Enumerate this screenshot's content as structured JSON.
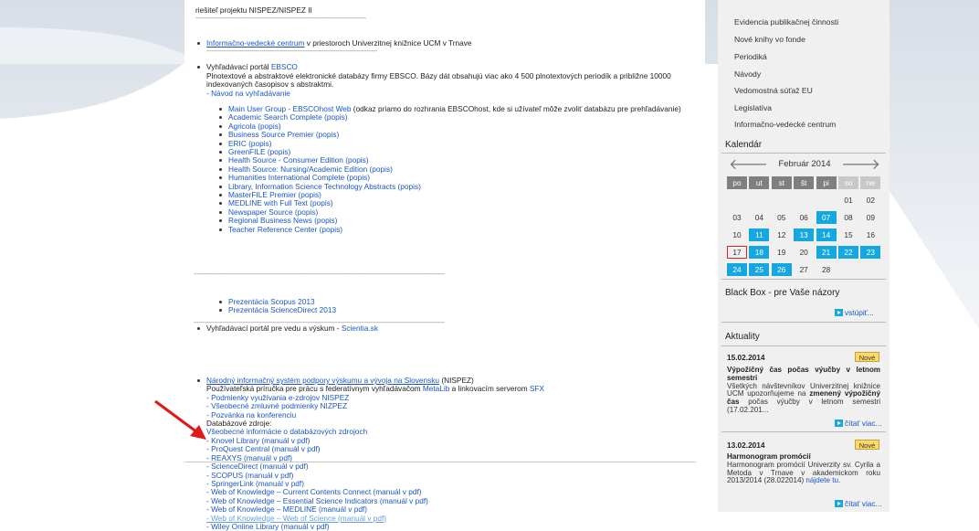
{
  "content": {
    "top_line": "riešiteľ projektu NISPEZ/NISPEZ II",
    "dashes_short": "------------------------------------------------------------------------------------------------------",
    "dashes_long": "------------------------------------------------------------------------------------------------------------------------------------------------------",
    "ivc_link": "Informačno-vedecké centrum",
    "ivc_rest": " v priestoroch Univerzitnej knižnice UCM v Trnave",
    "ebsco_prefix": "Vyhľadávací portál ",
    "ebsco_link": "EBSCO",
    "ebsco_desc": "Plnotextové a abstraktové elektronické databázy firmy EBSCO. Bázy dát obsahujú viac ako 4 500 plnotextových periodík a približne 10000 indexovaných časopisov s abstraktmi.",
    "navod_link": "- Návod na vyhľadávanie",
    "mug_link": "Main User Group - EBSCOhost Web",
    "mug_rest": " (odkaz priamo do rozhrania EBSCOhost, kde si užívateľ môže zvoliť databázu pre prehľadávanie)",
    "ebsco_items": [
      "Academic Search Complete (popis)",
      "Agricola (popis)",
      "Business Source Premier (popis)",
      "ERIC (popis)",
      "GreenFILE (popis)",
      "Health Source - Consumer Edition (popis)",
      "Health Source: Nursing/Academic Edition (popis)",
      "Humanities International Complete (popis)",
      "Library, Information Science Technology Abstracts (popis)",
      "MasterFILE Premier (popis)",
      "MEDLINE with Full Text (popis)",
      "Newspaper Source (popis)",
      "Regional Business News (popis)",
      "Teacher Reference Center (popis)"
    ],
    "scientia_prefix": "Vyhľadávací portál pre vedu a výskum - ",
    "scientia_link": "Scientia.sk",
    "scientia_items": [
      "Prezentácia Scopus 2013",
      "Prezentácia ScienceDirect 2013"
    ],
    "nispez_link": "Národný informačný systém podpory výskumu a vývoja na Slovensku",
    "nispez_rest": " (NISPEZ)",
    "nispez_line2_a": "Používateľská príručka pre prácu s federatívnym vyhľadávačom ",
    "nispez_metalib": "MetaLib",
    "nispez_line2_b": " a linkovacím serverom ",
    "nispez_sfx": "SFX",
    "nispez_links": [
      "- Podmienky využívania e-zdrojov NISPEZ",
      "- Všeobecné zmluvné podmienky NIZPEZ",
      "- Pozvánka na konferenciu"
    ],
    "db_label": "Databázové zdroje:",
    "db_general": "Všeobecné informácie o databázových zdrojoch",
    "db_items": [
      "- Knovel Library (manuál v pdf)",
      "- ProQuest Central (manuál v pdf)",
      "- REAXYS (manuál v pdf)",
      "- ScienceDirect (manuál v pdf)",
      "- SCOPUS (manuál v pdf)",
      "- SpringerLink (manuál v pdf)",
      "- Web of Knowledge – Current Contents Connect (manuál v pdf)",
      "- Web of Knowledge – Essential Science Indicators (manuál v pdf)",
      "- Web of Knowledge – MEDLINE (manuál v pdf)",
      "- Web of Knowledge – Web of Science (manuál v pdf)",
      "- Wiley Online Library (manuál v pdf)"
    ]
  },
  "sidebar": {
    "menu": [
      "Evidencia publikačnej činnosti",
      "Nové knihy vo fonde",
      "Periodiká",
      "Návody",
      "Vedomostná súťaž EU",
      "Legislatíva",
      "Informačno-vedecké centrum"
    ],
    "calendar_title": "Kalendár",
    "calendar": {
      "month": "Február 2014",
      "prev": "🡐",
      "next": "🡒",
      "days": [
        "po",
        "ut",
        "st",
        "št",
        "pi",
        "so",
        "ne"
      ],
      "weeks": [
        [
          "",
          "",
          "",
          "",
          "",
          "01",
          "02"
        ],
        [
          "03",
          "04",
          "05",
          "06",
          "07",
          "08",
          "09"
        ],
        [
          "10",
          "11",
          "12",
          "13",
          "14",
          "15",
          "16"
        ],
        [
          "17",
          "18",
          "19",
          "20",
          "21",
          "22",
          "23"
        ],
        [
          "24",
          "25",
          "26",
          "27",
          "28",
          "",
          ""
        ]
      ],
      "highlighted": [
        "07",
        "11",
        "13",
        "14",
        "18",
        "21",
        "22",
        "23",
        "24",
        "25",
        "26"
      ],
      "today": "17"
    },
    "blackbox_title": "Black Box  - pre Vaše názory",
    "blackbox_link": "vstúpiť...",
    "news_title": "Aktuality",
    "news": [
      {
        "date": "15.02.2014",
        "badge": "Nové",
        "headline": "Výpožičný čas počas výučby v letnom semestri",
        "text_a": "Všetkých návštevníkov Univerzitnej knižnice UCM upozorňujeme na ",
        "text_bold": "zmenený výpožičný čas",
        "text_b": " počas výučby v letnom semestri (17.02.201...",
        "more": "čítať viac..."
      },
      {
        "date": "13.02.2014",
        "badge": "Nové",
        "headline": "Harmonogram promócií",
        "text_a": "Harmonogram promócií Univerzity sv. Cyrila a Metoda v Trnave v akademickom roku 2013/2014 (28.022014) ",
        "text_link": "nájdete tu",
        "text_b": ".",
        "more": "čítať viac..."
      }
    ]
  },
  "colors": {
    "accent": "#14a7e0",
    "link": "#1a56c9",
    "annotation_arrow": "#e01818"
  }
}
